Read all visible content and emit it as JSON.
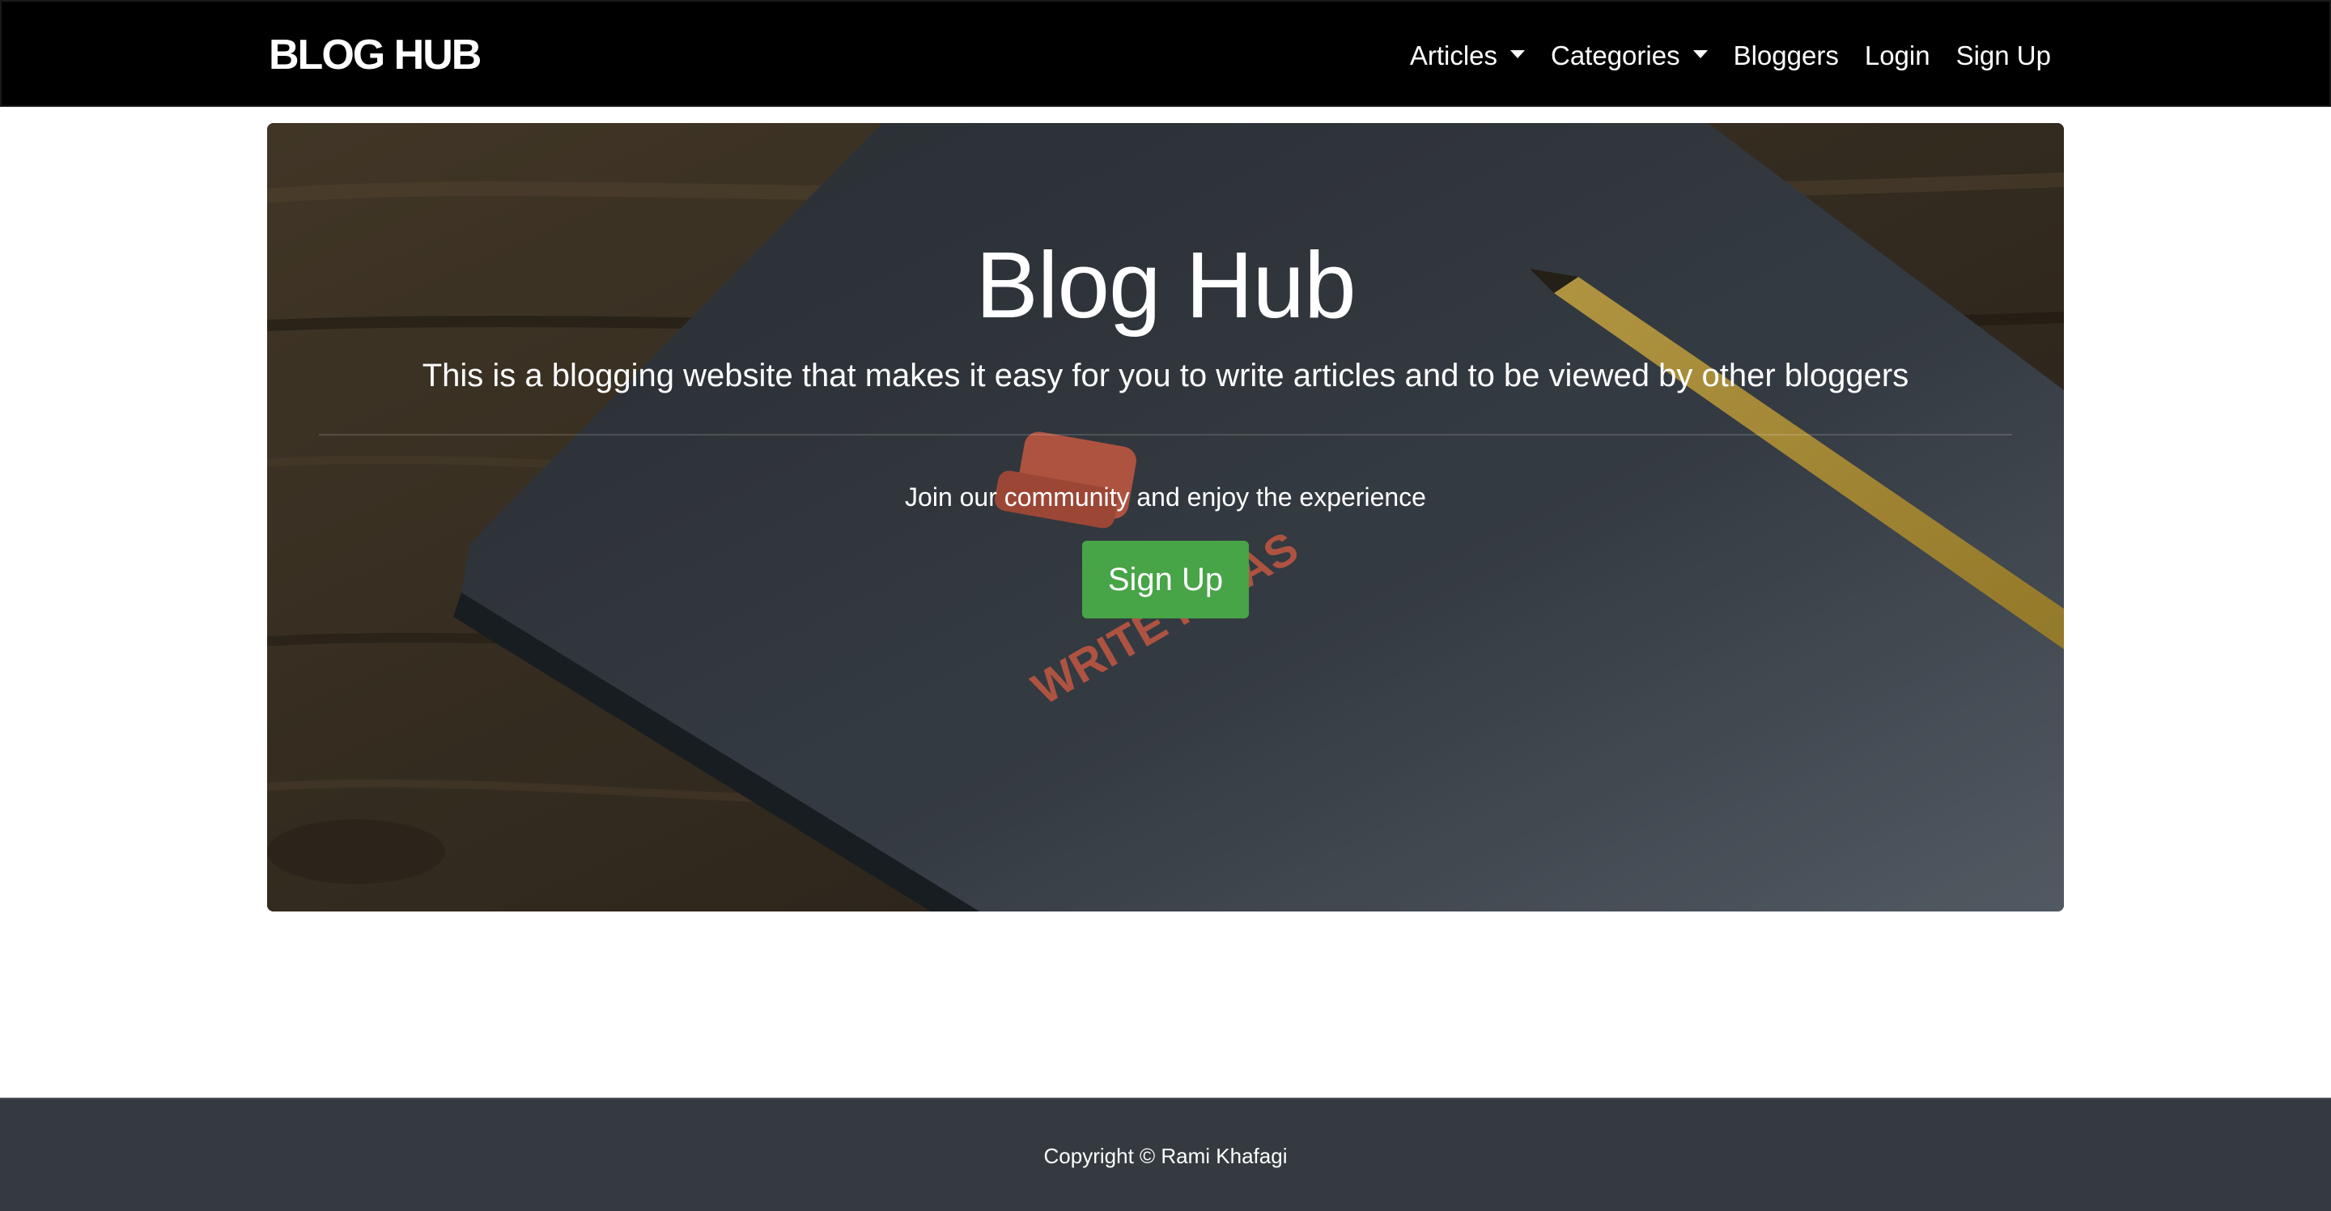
{
  "navbar": {
    "brand": "BLOG HUB",
    "items": [
      {
        "label": "Articles",
        "dropdown": true
      },
      {
        "label": "Categories",
        "dropdown": true
      },
      {
        "label": "Bloggers",
        "dropdown": false
      },
      {
        "label": "Login",
        "dropdown": false
      },
      {
        "label": "Sign Up",
        "dropdown": false
      }
    ]
  },
  "hero": {
    "title": "Blog Hub",
    "lead": "This is a blogging website that makes it easy for you to write articles and to be viewed by other bloggers",
    "subtext": "Join our community and enjoy the experience",
    "button_label": "Sign Up",
    "notebook_text": "WRITE IDEAS"
  },
  "footer": {
    "copyright": "Copyright © Rami Khafagi"
  },
  "colors": {
    "navbar_bg": "#000000",
    "button_bg": "#47a447",
    "footer_bg": "#343a40"
  }
}
